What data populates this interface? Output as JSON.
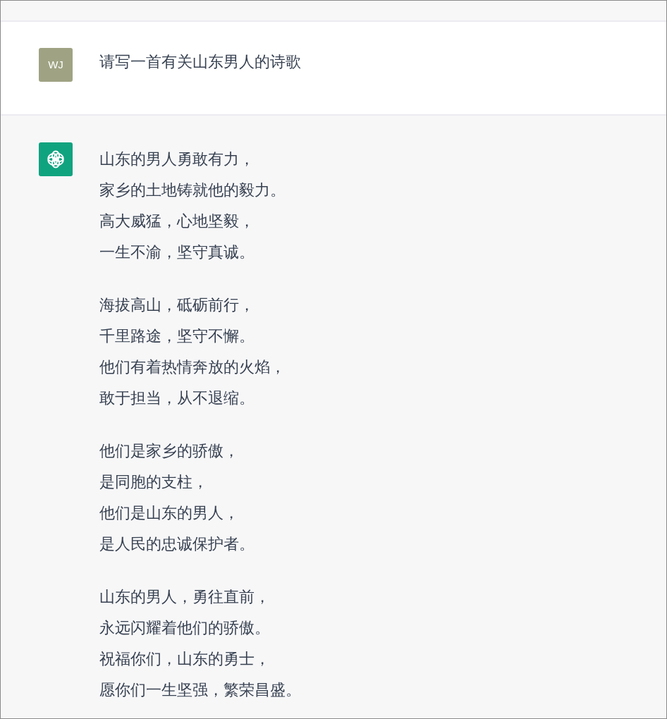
{
  "messages": [
    {
      "kind": "user",
      "avatar_text": "WJ",
      "text": "请写一首有关山东男人的诗歌"
    },
    {
      "kind": "assistant",
      "stanzas": [
        [
          "山东的男人勇敢有力，",
          "家乡的土地铸就他的毅力。",
          "高大威猛，心地坚毅，",
          "一生不渝，坚守真诚。"
        ],
        [
          "海拔高山，砥砺前行，",
          "千里路途，坚守不懈。",
          "他们有着热情奔放的火焰，",
          "敢于担当，从不退缩。"
        ],
        [
          "他们是家乡的骄傲，",
          "是同胞的支柱，",
          "他们是山东的男人，",
          "是人民的忠诚保护者。"
        ],
        [
          "山东的男人，勇往直前，",
          "永远闪耀着他们的骄傲。",
          "祝福你们，山东的勇士，",
          "愿你们一生坚强，繁荣昌盛。"
        ]
      ]
    }
  ]
}
